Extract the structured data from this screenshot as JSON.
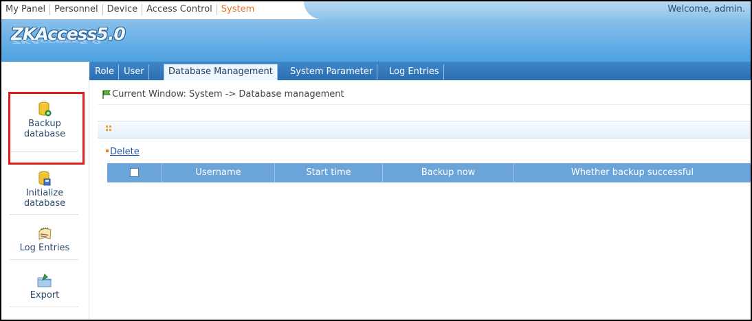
{
  "topnav": {
    "items": [
      {
        "label": "My Panel"
      },
      {
        "label": "Personnel"
      },
      {
        "label": "Device"
      },
      {
        "label": "Access Control"
      },
      {
        "label": "System",
        "active": true
      }
    ],
    "welcome": "Welcome, admin."
  },
  "header": {
    "logo_text": "ZKAccess5.0"
  },
  "tabs": [
    {
      "label": "Role"
    },
    {
      "label": "User"
    },
    {
      "label": "Database Management",
      "active": true
    },
    {
      "label": "System Parameter"
    },
    {
      "label": "Log Entries"
    }
  ],
  "sidebar": {
    "items": [
      {
        "label1": "Backup",
        "label2": "database",
        "icon": "database-backup-icon"
      },
      {
        "label1": "Initialize",
        "label2": "database",
        "icon": "database-init-icon"
      },
      {
        "label1": "Log Entries",
        "label2": "",
        "icon": "notepad-icon"
      },
      {
        "label1": "Export",
        "label2": "",
        "icon": "folder-export-icon"
      }
    ]
  },
  "main": {
    "breadcrumb": "Current Window: System -> Database management",
    "delete_label": "Delete",
    "table": {
      "columns": [
        "",
        "Username",
        "Start time",
        "Backup now",
        "Whether backup successful"
      ],
      "rows": []
    }
  },
  "colors": {
    "accent": "#e8752a",
    "header_blue": "#64aee6",
    "tab_bar": "#2a6fb2",
    "grid_header": "#6aa4d8",
    "highlight": "#e21b1b"
  }
}
